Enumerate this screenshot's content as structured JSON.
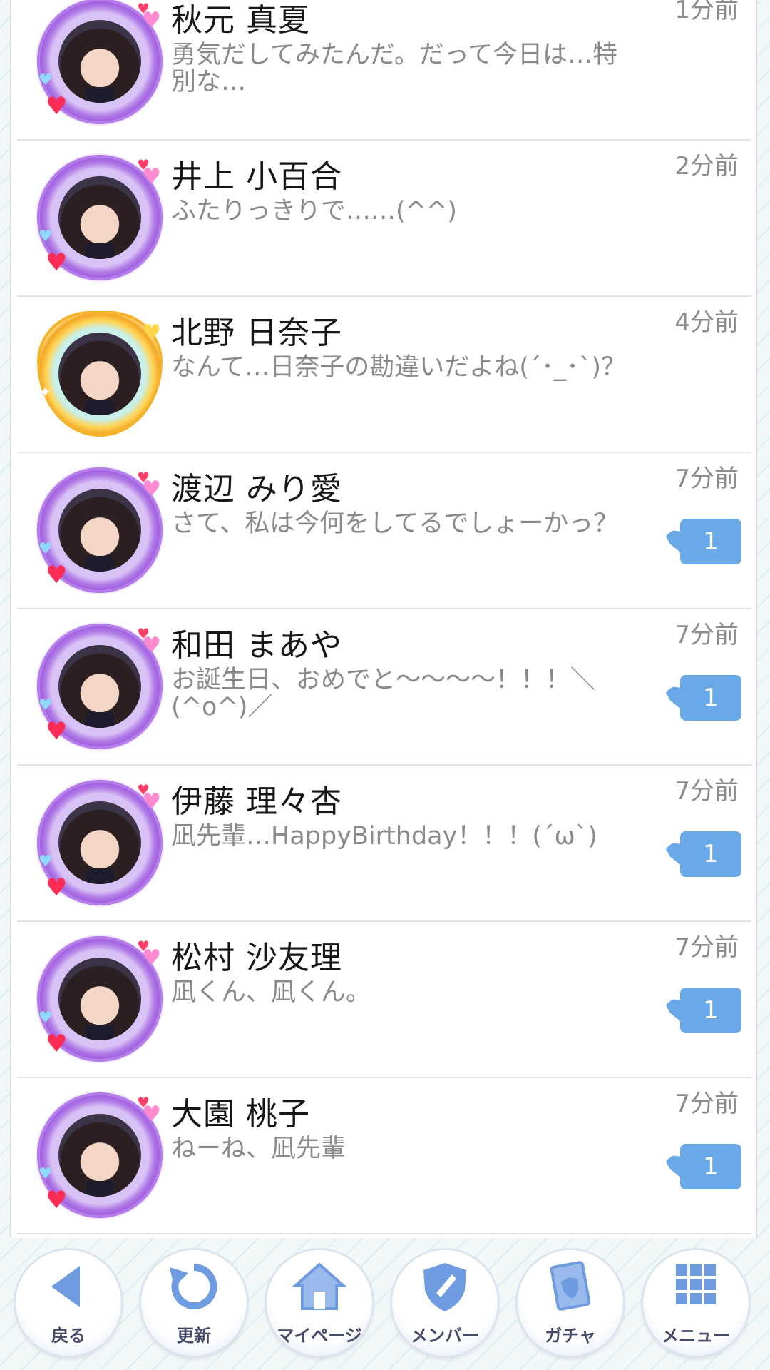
{
  "colors": {
    "badge": "#6aa9e8",
    "icon": "#6f9be0",
    "name_text": "#161616",
    "message_text": "#8a8a8a"
  },
  "threads": [
    {
      "name": "秋元 真夏",
      "message": "勇気だしてみたんだ。だって今日は…特別な…",
      "time": "1分前",
      "unread": null,
      "frame": "purple"
    },
    {
      "name": "井上 小百合",
      "message": "ふたりっきりで……(^^)",
      "time": "2分前",
      "unread": null,
      "frame": "purple"
    },
    {
      "name": "北野 日奈子",
      "message": "なんて…日奈子の勘違いだよね(´･_･`)？",
      "time": "4分前",
      "unread": null,
      "frame": "gold"
    },
    {
      "name": "渡辺 みり愛",
      "message": "さて、私は今何をしてるでしょーかっ？",
      "time": "7分前",
      "unread": "1",
      "frame": "purple"
    },
    {
      "name": "和田 まあや",
      "message": "お誕生日、おめでと〜〜〜〜！！！＼(^o^)／",
      "time": "7分前",
      "unread": "1",
      "frame": "purple"
    },
    {
      "name": "伊藤 理々杏",
      "message": "凪先輩…HappyBirthday！！！(´ω`)",
      "time": "7分前",
      "unread": "1",
      "frame": "purple"
    },
    {
      "name": "松村 沙友理",
      "message": "凪くん、凪くん。",
      "time": "7分前",
      "unread": "1",
      "frame": "purple"
    },
    {
      "name": "大園 桃子",
      "message": "ねーね、凪先輩",
      "time": "7分前",
      "unread": "1",
      "frame": "purple"
    }
  ],
  "nav": [
    {
      "label": "戻る",
      "icon": "back-arrow-icon"
    },
    {
      "label": "更新",
      "icon": "refresh-icon"
    },
    {
      "label": "マイページ",
      "icon": "home-icon"
    },
    {
      "label": "メンバー",
      "icon": "shield-icon"
    },
    {
      "label": "ガチャ",
      "icon": "card-icon"
    },
    {
      "label": "メニュー",
      "icon": "grid-menu-icon"
    }
  ]
}
